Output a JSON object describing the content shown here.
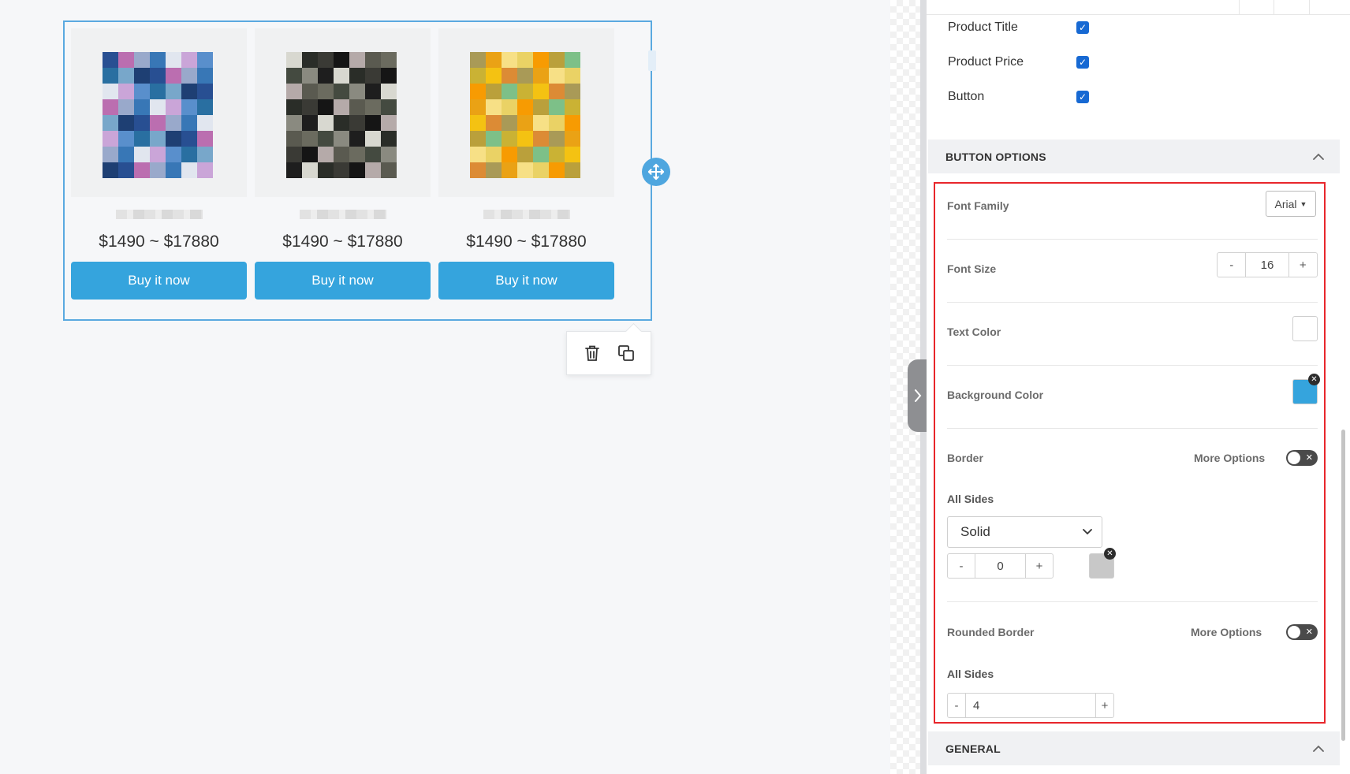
{
  "products": [
    {
      "price": "$1490 ~ $17880",
      "button": "Buy it now"
    },
    {
      "price": "$1490 ~ $17880",
      "button": "Buy it now"
    },
    {
      "price": "$1490 ~ $17880",
      "button": "Buy it now"
    }
  ],
  "icons": {
    "move": "move-icon",
    "delete": "trash-icon",
    "duplicate": "duplicate-icon",
    "collapse": "chevron-right-icon",
    "section_toggle": "chevron-up-icon",
    "check": "check-icon",
    "clear": "close-icon",
    "dropdown": "caret-down-icon"
  },
  "visibility": {
    "items": [
      {
        "label": "Product Title",
        "checked": true
      },
      {
        "label": "Product Price",
        "checked": true
      },
      {
        "label": "Button",
        "checked": true
      }
    ]
  },
  "button_options": {
    "header": "BUTTON OPTIONS",
    "font_family": {
      "label": "Font Family",
      "value": "Arial"
    },
    "font_size": {
      "label": "Font Size",
      "value": "16",
      "dec": "-",
      "inc": "+"
    },
    "text_color": {
      "label": "Text Color",
      "value": "#ffffff"
    },
    "background_color": {
      "label": "Background Color",
      "value": "#35a4dd"
    },
    "border": {
      "label": "Border",
      "more_options": "More Options",
      "sides_label": "All Sides",
      "style": "Solid",
      "width": "0",
      "dec": "-",
      "inc": "+",
      "color": "#c8c8c8"
    },
    "rounded_border": {
      "label": "Rounded Border",
      "more_options": "More Options",
      "sides_label": "All Sides",
      "value": "4",
      "dec": "-",
      "inc": "+"
    }
  },
  "general": {
    "header": "GENERAL"
  },
  "colors": {
    "accent": "#35a4dd",
    "selection_outline": "#5aa9e0",
    "highlight_box": "#e8262b",
    "checkbox": "#1769d3"
  }
}
